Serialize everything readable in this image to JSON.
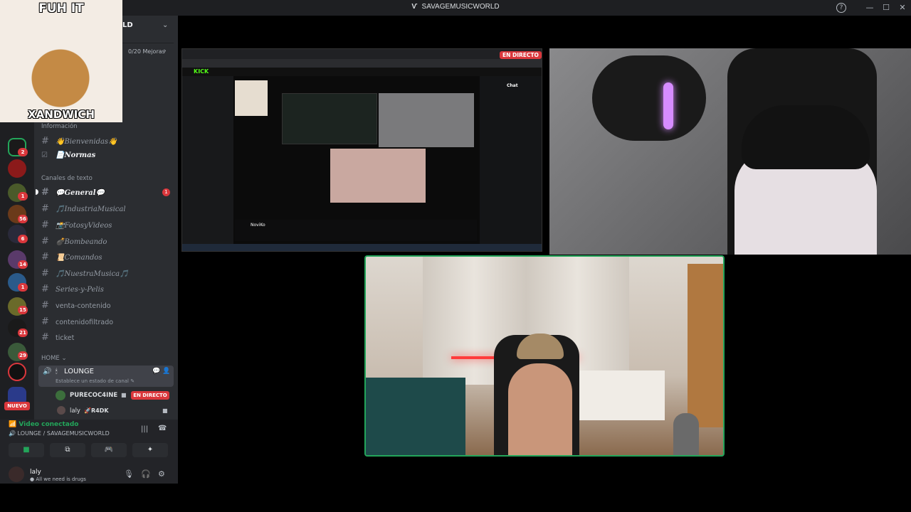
{
  "window": {
    "title": "SAVAGEMUSICWORLD",
    "title_glyph": "Ѵ",
    "help_label": "?",
    "minimize_label": "—",
    "maximize_label": "☐",
    "close_label": "✕"
  },
  "meme": {
    "top_text": "FUH IT",
    "bottom_text": "XANDWICH"
  },
  "server": {
    "name_fragment": "LD",
    "boosts": "0/20 Mejoras"
  },
  "categories": {
    "info": "Información",
    "text": "Canales de texto",
    "home": "HOME"
  },
  "channels": [
    {
      "emoji": "👋",
      "name": "Bienvenidas",
      "suffix": "👋"
    },
    {
      "emoji": "📄",
      "name": "Normas",
      "suffix": ""
    },
    {
      "emoji": "💬",
      "name": "General",
      "suffix": "💬"
    },
    {
      "emoji": "🎵",
      "name": "IndustriaMusical",
      "suffix": ""
    },
    {
      "emoji": "📸",
      "name": "FotosyVideos",
      "suffix": ""
    },
    {
      "emoji": "💣",
      "name": "Bombeando",
      "suffix": ""
    },
    {
      "emoji": "📜",
      "name": "Comandos",
      "suffix": ""
    },
    {
      "emoji": "🎵",
      "name": "NuestraMusica",
      "suffix": "🎵"
    },
    {
      "emoji": "",
      "name": "Series-y-Pelis",
      "suffix": ""
    },
    {
      "emoji": "",
      "name": "venta-contenido",
      "suffix": ""
    },
    {
      "emoji": "",
      "name": "contenidofiltrado",
      "suffix": ""
    },
    {
      "emoji": "",
      "name": "ticket",
      "suffix": ""
    }
  ],
  "general_badge": "1",
  "server_badges": [
    "2",
    "1",
    "56",
    "6",
    "14",
    "1",
    "15",
    "21",
    "29"
  ],
  "nuevo_label": "NUEVO",
  "voice": {
    "channel_name": "LOUNGE",
    "status_placeholder": "Establece un estado de canal",
    "members": [
      {
        "name": "PURECOC4INE",
        "live": "EN DIRECTO"
      },
      {
        "name": "laly",
        "tag": "R4DK"
      }
    ]
  },
  "connection": {
    "status": "Video conectado",
    "channel": "LOUNGE / SAVAGEMUSICWORLD"
  },
  "user": {
    "name": "laly",
    "status": "All we need is drugs"
  },
  "streams": {
    "screen_live": "EN DIRECTO",
    "kick_logo": "KICK",
    "kick_chat_label": "Chat",
    "kick_streamer": "NoviKo"
  },
  "colors": {
    "live_red": "#da373c",
    "connected_green": "#23a55a",
    "sidebar_bg": "#2b2d31",
    "rail_bg": "#1e1f22",
    "kick_green": "#53fc18"
  }
}
